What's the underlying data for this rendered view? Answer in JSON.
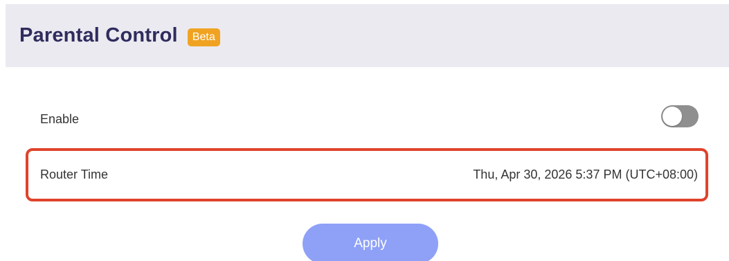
{
  "header": {
    "title": "Parental Control",
    "badge": "Beta"
  },
  "settings": {
    "enable": {
      "label": "Enable",
      "toggle_on": false
    },
    "router_time": {
      "label": "Router Time",
      "value": "Thu, Apr 30, 2026 5:37 PM (UTC+08:00)"
    }
  },
  "actions": {
    "apply_label": "Apply"
  },
  "colors": {
    "header_bg": "#ebeaf0",
    "title": "#2f2c5e",
    "badge_bg": "#f0a323",
    "toggle_off": "#8f8f8f",
    "highlight_border": "#e0432b",
    "apply_bg": "#8ea1f7"
  }
}
